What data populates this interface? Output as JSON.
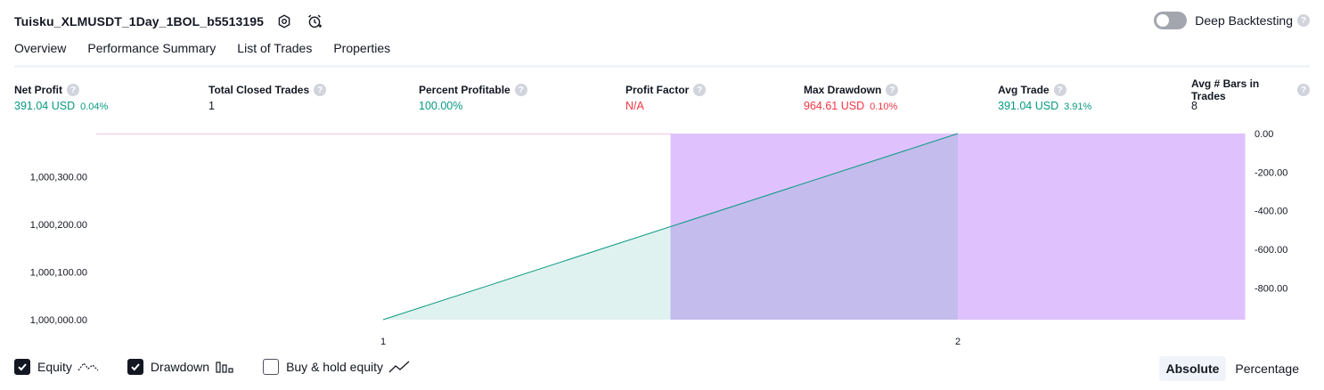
{
  "header": {
    "strategy_title": "Tuisku_XLMUSDT_1Day_1BOL_b5513195",
    "settings_icon": "gear-icon",
    "alert_icon": "alarm-clock-plus-icon",
    "deep_backtesting_label": "Deep Backtesting",
    "deep_backtesting_enabled": false,
    "help_glyph": "?"
  },
  "tabs": [
    {
      "label": "Overview",
      "active": true
    },
    {
      "label": "Performance Summary",
      "active": false
    },
    {
      "label": "List of Trades",
      "active": false
    },
    {
      "label": "Properties",
      "active": false
    }
  ],
  "metrics": [
    {
      "label": "Net Profit",
      "value": "391.04 USD",
      "pct": "0.04%",
      "color": "#089981"
    },
    {
      "label": "Total Closed Trades",
      "value": "1",
      "pct": "",
      "color": "#131722"
    },
    {
      "label": "Percent Profitable",
      "value": "100.00%",
      "pct": "",
      "color": "#089981"
    },
    {
      "label": "Profit Factor",
      "value": "N/A",
      "pct": "",
      "color": "#f23645"
    },
    {
      "label": "Max Drawdown",
      "value": "964.61 USD",
      "pct": "0.10%",
      "color": "#f23645"
    },
    {
      "label": "Avg Trade",
      "value": "391.04 USD",
      "pct": "3.91%",
      "color": "#089981"
    },
    {
      "label": "Avg # Bars in Trades",
      "value": "8",
      "pct": "",
      "color": "#131722"
    }
  ],
  "chart_data": {
    "type": "area",
    "x_ticks": [
      "1",
      "2"
    ],
    "left_axis": {
      "ticks": [
        "1,000,000.00",
        "1,000,100.00",
        "1,000,200.00",
        "1,000,300.00"
      ],
      "tick_values": [
        1000000,
        1000100,
        1000200,
        1000300
      ],
      "range": [
        1000000,
        1000391.04
      ]
    },
    "right_axis": {
      "ticks": [
        "0.00",
        "-200.00",
        "-400.00",
        "-600.00",
        "-800.00"
      ],
      "tick_values": [
        0,
        -200,
        -400,
        -600,
        -800
      ],
      "range": [
        -964.61,
        0
      ]
    },
    "series": [
      {
        "name": "Equity",
        "x": [
          1,
          2
        ],
        "values": [
          1000000,
          1000391.04
        ],
        "color": "#089981",
        "fill": "rgba(8,153,129,0.12)"
      },
      {
        "name": "Drawdown",
        "bars": [
          {
            "x_start": 1.5,
            "x_end": 2,
            "value": -964.61
          },
          {
            "x_start": 2,
            "x_end": 2.5,
            "value": -964.61
          }
        ],
        "color": "#d9b3fc",
        "fill": "rgba(204,153,255,0.6)"
      }
    ],
    "grid": false
  },
  "legend": {
    "items": [
      {
        "label": "Equity",
        "checked": true,
        "icon": "equity-line-icon"
      },
      {
        "label": "Drawdown",
        "checked": true,
        "icon": "drawdown-bars-icon"
      },
      {
        "label": "Buy & hold equity",
        "checked": false,
        "icon": "buy-hold-line-icon"
      }
    ]
  },
  "mode": {
    "absolute_label": "Absolute",
    "percentage_label": "Percentage",
    "selected": "Absolute"
  }
}
